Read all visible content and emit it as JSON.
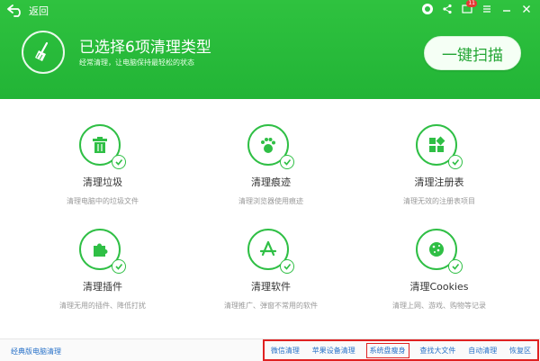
{
  "header": {
    "back_label": "返回",
    "title": "已选择6项清理类型",
    "subtitle": "经常清理，让电脑保持最轻松的状态",
    "scan_button": "一键扫描",
    "notification_count": "11",
    "accent_color": "#22b436"
  },
  "items": [
    {
      "name": "清理垃圾",
      "desc": "清理电脑中的垃圾文件",
      "icon": "trash-icon"
    },
    {
      "name": "清理痕迹",
      "desc": "清理浏览器使用痕迹",
      "icon": "footprint-icon"
    },
    {
      "name": "清理注册表",
      "desc": "清理无效的注册表项目",
      "icon": "registry-icon"
    },
    {
      "name": "清理插件",
      "desc": "清理无用的插件、降低打扰",
      "icon": "puzzle-icon"
    },
    {
      "name": "清理软件",
      "desc": "清理推广、弹窗不常用的软件",
      "icon": "app-store-icon"
    },
    {
      "name": "清理Cookies",
      "desc": "清理上网、游戏、购物等记录",
      "icon": "cookie-icon"
    }
  ],
  "footer": {
    "classic_link": "经典版电脑清理",
    "links": [
      "微信清理",
      "苹果设备清理",
      "系统盘瘦身",
      "查找大文件",
      "自动清理",
      "恢复区"
    ]
  }
}
